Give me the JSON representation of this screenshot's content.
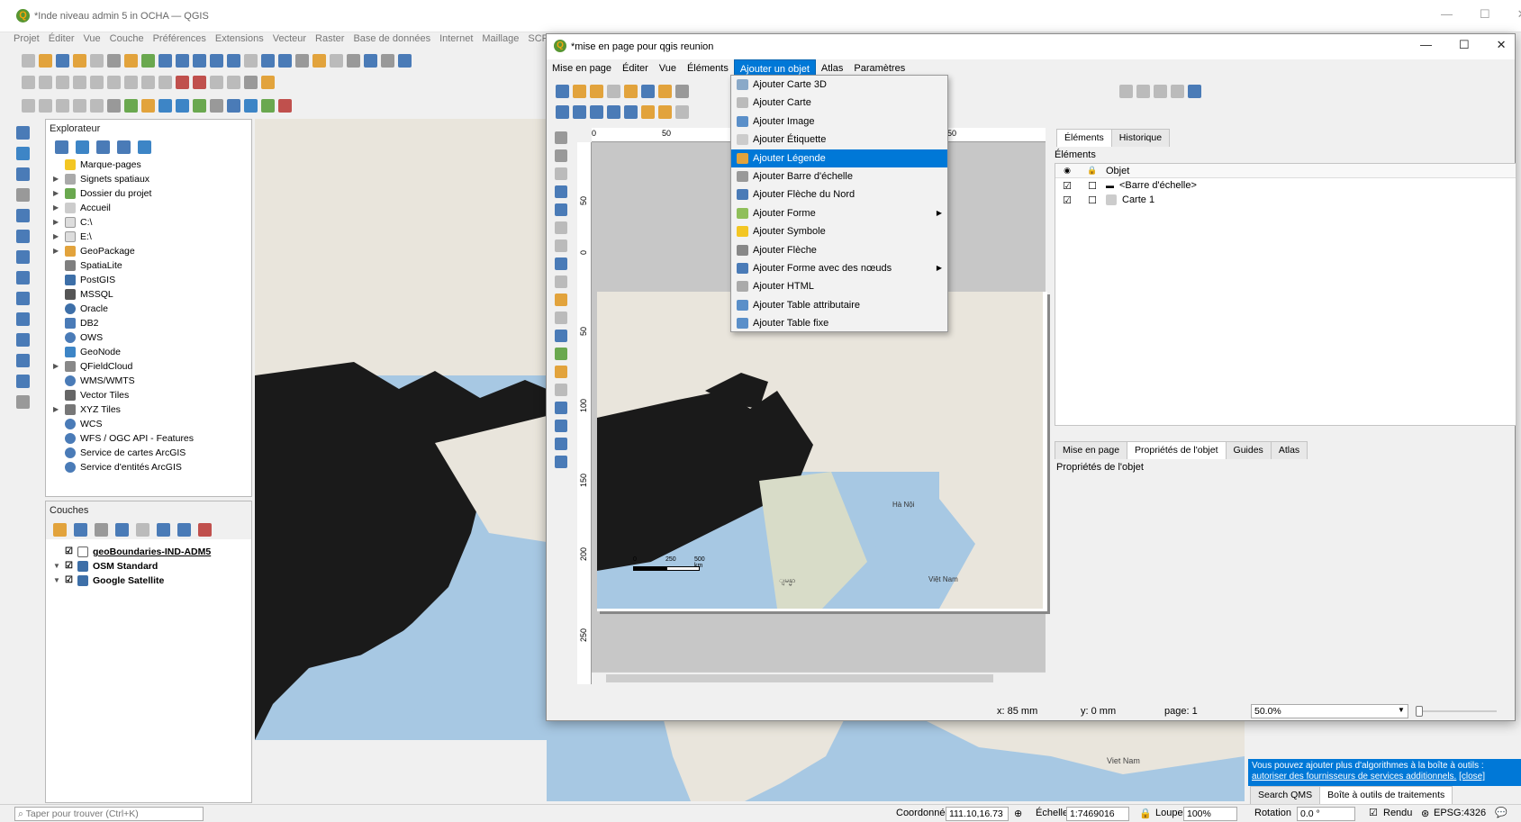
{
  "main_window": {
    "title": "*Inde niveau admin 5 in OCHA — QGIS",
    "menus": [
      "Projet",
      "Éditer",
      "Vue",
      "Couche",
      "Préférences",
      "Extensions",
      "Vecteur",
      "Raster",
      "Base de données",
      "Internet",
      "Maillage",
      "SCP"
    ]
  },
  "explorer": {
    "title": "Explorateur",
    "items": [
      "Marque-pages",
      "Signets spatiaux",
      "Dossier du projet",
      "Accueil",
      "C:\\",
      "E:\\",
      "GeoPackage",
      "SpatiaLite",
      "PostGIS",
      "MSSQL",
      "Oracle",
      "DB2",
      "OWS",
      "GeoNode",
      "QFieldCloud",
      "WMS/WMTS",
      "Vector Tiles",
      "XYZ Tiles",
      "WCS",
      "WFS / OGC API - Features",
      "Service de cartes ArcGIS",
      "Service d'entités ArcGIS"
    ]
  },
  "layers": {
    "title": "Couches",
    "items": [
      "geoBoundaries-IND-ADM5",
      "OSM Standard",
      "Google Satellite"
    ]
  },
  "layout_window": {
    "title": "*mise en page pour qgis reunion",
    "menus": [
      "Mise en page",
      "Éditer",
      "Vue",
      "Éléments",
      "Ajouter un objet",
      "Atlas",
      "Paramètres"
    ],
    "active_menu": "Ajouter un objet"
  },
  "add_menu": {
    "items": [
      "Ajouter Carte 3D",
      "Ajouter Carte",
      "Ajouter Image",
      "Ajouter Étiquette",
      "Ajouter Légende",
      "Ajouter Barre d'échelle",
      "Ajouter Flèche du Nord",
      "Ajouter Forme",
      "Ajouter Symbole",
      "Ajouter Flèche",
      "Ajouter Forme avec des nœuds",
      "Ajouter HTML",
      "Ajouter Table attributaire",
      "Ajouter Table fixe"
    ],
    "highlighted": "Ajouter Légende"
  },
  "ruler": {
    "top": [
      "0",
      "50",
      "250"
    ],
    "left": [
      "50",
      "0",
      "50",
      "100",
      "150",
      "200",
      "250"
    ]
  },
  "scalebar": {
    "labels": [
      "0",
      "250",
      "500 km"
    ]
  },
  "elements_panel": {
    "tabs": [
      "Éléments",
      "Historique"
    ],
    "title": "Éléments",
    "col_object": "Objet",
    "rows": [
      "<Barre d'échelle>",
      "Carte 1"
    ]
  },
  "props_panel": {
    "tabs": [
      "Mise en page",
      "Propriétés de l'objet",
      "Guides",
      "Atlas"
    ],
    "title": "Propriétés de l'objet"
  },
  "layout_status": {
    "x": "x: 85 mm",
    "y": "y: 0 mm",
    "page": "page: 1",
    "zoom": "50.0%"
  },
  "notice": {
    "text": "Vous pouvez ajouter plus d'algorithmes à la boîte à outils :",
    "link": "autoriser des fournisseurs de services additionnels.",
    "close": "[close]"
  },
  "bottom_tabs": [
    "Search QMS",
    "Boîte à outils de traitements"
  ],
  "statusbar": {
    "search_placeholder": "Taper pour trouver (Ctrl+K)",
    "coord_label": "Coordonnée",
    "coord": "111.10,16.73",
    "scale_label": "Échelle",
    "scale": "1:7469016",
    "magnifier_label": "Loupe",
    "magnifier": "100%",
    "rotation_label": "Rotation",
    "rotation": "0.0 °",
    "render_label": "Rendu",
    "crs": "EPSG:4326"
  },
  "map_labels": {
    "hanoi": "Hà Nội",
    "vietnam": "Việt Nam",
    "myanmar": "ျမန္မာ",
    "cotton": "Viet Nam"
  },
  "colors": {
    "accent": "#0078d7",
    "water": "#a7c8e3",
    "land": "#e9e5dc",
    "dark": "#1a1a1a"
  }
}
